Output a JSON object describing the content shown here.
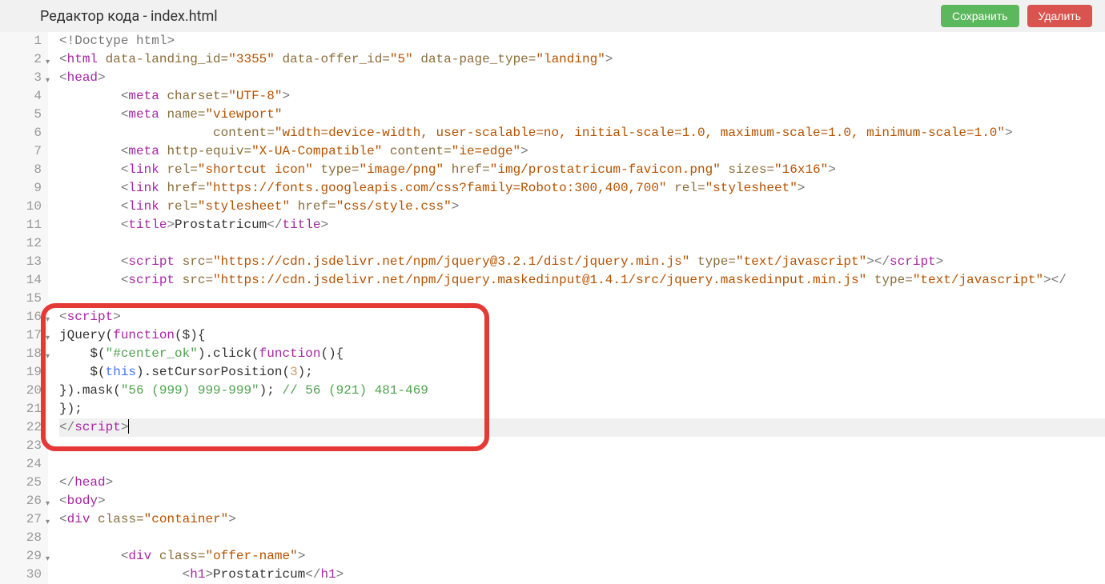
{
  "header": {
    "title": "Редактор кода - index.html",
    "save_label": "Сохранить",
    "delete_label": "Удалить"
  },
  "editor": {
    "active_line": 22,
    "lines": [
      {
        "n": 1,
        "fold": false,
        "tokens": [
          [
            "angle",
            "<"
          ],
          [
            "doctype",
            "!Doctype html"
          ],
          [
            "angle",
            ">"
          ]
        ]
      },
      {
        "n": 2,
        "fold": true,
        "tokens": [
          [
            "angle",
            "<"
          ],
          [
            "name",
            "html"
          ],
          [
            "text",
            " "
          ],
          [
            "attr",
            "data-landing_id"
          ],
          [
            "eq",
            "="
          ],
          [
            "str",
            "\"3355\""
          ],
          [
            "text",
            " "
          ],
          [
            "attr",
            "data-offer_id"
          ],
          [
            "eq",
            "="
          ],
          [
            "str",
            "\"5\""
          ],
          [
            "text",
            " "
          ],
          [
            "attr",
            "data-page_type"
          ],
          [
            "eq",
            "="
          ],
          [
            "str",
            "\"landing\""
          ],
          [
            "angle",
            ">"
          ]
        ]
      },
      {
        "n": 3,
        "fold": true,
        "tokens": [
          [
            "angle",
            "<"
          ],
          [
            "name",
            "head"
          ],
          [
            "angle",
            ">"
          ]
        ]
      },
      {
        "n": 4,
        "fold": false,
        "indent": 2,
        "tokens": [
          [
            "angle",
            "<"
          ],
          [
            "name",
            "meta"
          ],
          [
            "text",
            " "
          ],
          [
            "attr",
            "charset"
          ],
          [
            "eq",
            "="
          ],
          [
            "str",
            "\"UTF-8\""
          ],
          [
            "angle",
            ">"
          ]
        ]
      },
      {
        "n": 5,
        "fold": false,
        "indent": 2,
        "tokens": [
          [
            "angle",
            "<"
          ],
          [
            "name",
            "meta"
          ],
          [
            "text",
            " "
          ],
          [
            "attr",
            "name"
          ],
          [
            "eq",
            "="
          ],
          [
            "str",
            "\"viewport\""
          ]
        ]
      },
      {
        "n": 6,
        "fold": false,
        "indent": 5,
        "tokens": [
          [
            "attr",
            "content"
          ],
          [
            "eq",
            "="
          ],
          [
            "str",
            "\"width=device-width, user-scalable=no, initial-scale=1.0, maximum-scale=1.0, minimum-scale=1.0\""
          ],
          [
            "angle",
            ">"
          ]
        ]
      },
      {
        "n": 7,
        "fold": false,
        "indent": 2,
        "tokens": [
          [
            "angle",
            "<"
          ],
          [
            "name",
            "meta"
          ],
          [
            "text",
            " "
          ],
          [
            "attr",
            "http-equiv"
          ],
          [
            "eq",
            "="
          ],
          [
            "str",
            "\"X-UA-Compatible\""
          ],
          [
            "text",
            " "
          ],
          [
            "attr",
            "content"
          ],
          [
            "eq",
            "="
          ],
          [
            "str",
            "\"ie=edge\""
          ],
          [
            "angle",
            ">"
          ]
        ]
      },
      {
        "n": 8,
        "fold": false,
        "indent": 2,
        "tokens": [
          [
            "angle",
            "<"
          ],
          [
            "name",
            "link"
          ],
          [
            "text",
            " "
          ],
          [
            "attr",
            "rel"
          ],
          [
            "eq",
            "="
          ],
          [
            "str",
            "\"shortcut icon\""
          ],
          [
            "text",
            " "
          ],
          [
            "attr",
            "type"
          ],
          [
            "eq",
            "="
          ],
          [
            "str",
            "\"image/png\""
          ],
          [
            "text",
            " "
          ],
          [
            "attr",
            "href"
          ],
          [
            "eq",
            "="
          ],
          [
            "str",
            "\"img/prostatricum-favicon.png\""
          ],
          [
            "text",
            " "
          ],
          [
            "attr",
            "sizes"
          ],
          [
            "eq",
            "="
          ],
          [
            "str",
            "\"16x16\""
          ],
          [
            "angle",
            ">"
          ]
        ]
      },
      {
        "n": 9,
        "fold": false,
        "indent": 2,
        "tokens": [
          [
            "angle",
            "<"
          ],
          [
            "name",
            "link"
          ],
          [
            "text",
            " "
          ],
          [
            "attr",
            "href"
          ],
          [
            "eq",
            "="
          ],
          [
            "str",
            "\"https://fonts.googleapis.com/css?family=Roboto:300,400,700\""
          ],
          [
            "text",
            " "
          ],
          [
            "attr",
            "rel"
          ],
          [
            "eq",
            "="
          ],
          [
            "str",
            "\"stylesheet\""
          ],
          [
            "angle",
            ">"
          ]
        ]
      },
      {
        "n": 10,
        "fold": false,
        "indent": 2,
        "tokens": [
          [
            "angle",
            "<"
          ],
          [
            "name",
            "link"
          ],
          [
            "text",
            " "
          ],
          [
            "attr",
            "rel"
          ],
          [
            "eq",
            "="
          ],
          [
            "str",
            "\"stylesheet\""
          ],
          [
            "text",
            " "
          ],
          [
            "attr",
            "href"
          ],
          [
            "eq",
            "="
          ],
          [
            "str",
            "\"css/style.css\""
          ],
          [
            "angle",
            ">"
          ]
        ]
      },
      {
        "n": 11,
        "fold": false,
        "indent": 2,
        "tokens": [
          [
            "angle",
            "<"
          ],
          [
            "name",
            "title"
          ],
          [
            "angle",
            ">"
          ],
          [
            "text",
            "Prostatricum"
          ],
          [
            "angle",
            "</"
          ],
          [
            "name",
            "title"
          ],
          [
            "angle",
            ">"
          ]
        ]
      },
      {
        "n": 12,
        "fold": false,
        "tokens": []
      },
      {
        "n": 13,
        "fold": false,
        "indent": 2,
        "tokens": [
          [
            "angle",
            "<"
          ],
          [
            "name",
            "script"
          ],
          [
            "text",
            " "
          ],
          [
            "attr",
            "src"
          ],
          [
            "eq",
            "="
          ],
          [
            "str",
            "\"https://cdn.jsdelivr.net/npm/jquery@3.2.1/dist/jquery.min.js\""
          ],
          [
            "text",
            " "
          ],
          [
            "attr",
            "type"
          ],
          [
            "eq",
            "="
          ],
          [
            "str",
            "\"text/javascript\""
          ],
          [
            "angle",
            ">"
          ],
          [
            "angle",
            "</"
          ],
          [
            "name",
            "script"
          ],
          [
            "angle",
            ">"
          ]
        ]
      },
      {
        "n": 14,
        "fold": false,
        "indent": 2,
        "tokens": [
          [
            "angle",
            "<"
          ],
          [
            "name",
            "script"
          ],
          [
            "text",
            " "
          ],
          [
            "attr",
            "src"
          ],
          [
            "eq",
            "="
          ],
          [
            "str",
            "\"https://cdn.jsdelivr.net/npm/jquery.maskedinput@1.4.1/src/jquery.maskedinput.min.js\""
          ],
          [
            "text",
            " "
          ],
          [
            "attr",
            "type"
          ],
          [
            "eq",
            "="
          ],
          [
            "str",
            "\"text/javascript\""
          ],
          [
            "angle",
            ">"
          ],
          [
            "angle",
            "</"
          ]
        ]
      },
      {
        "n": 15,
        "fold": false,
        "tokens": []
      },
      {
        "n": 16,
        "fold": true,
        "tokens": [
          [
            "angle",
            "<"
          ],
          [
            "name",
            "script"
          ],
          [
            "angle",
            ">"
          ]
        ]
      },
      {
        "n": 17,
        "fold": true,
        "tokens": [
          [
            "js-var",
            "jQuery"
          ],
          [
            "text",
            "("
          ],
          [
            "js-kw",
            "function"
          ],
          [
            "text",
            "($){"
          ]
        ]
      },
      {
        "n": 18,
        "fold": true,
        "indent": 1,
        "tokens": [
          [
            "text",
            "$("
          ],
          [
            "js-str",
            "\"#center_ok\""
          ],
          [
            "text",
            ")."
          ],
          [
            "js-var",
            "click"
          ],
          [
            "text",
            "("
          ],
          [
            "js-kw",
            "function"
          ],
          [
            "text",
            "(){"
          ]
        ]
      },
      {
        "n": 19,
        "fold": false,
        "indent": 1,
        "tokens": [
          [
            "text",
            "$("
          ],
          [
            "js-this",
            "this"
          ],
          [
            "text",
            ")."
          ],
          [
            "js-var",
            "setCursorPosition"
          ],
          [
            "text",
            "("
          ],
          [
            "js-num",
            "3"
          ],
          [
            "text",
            ");"
          ]
        ]
      },
      {
        "n": 20,
        "fold": false,
        "tokens": [
          [
            "text",
            "})."
          ],
          [
            "js-var",
            "mask"
          ],
          [
            "text",
            "("
          ],
          [
            "js-str",
            "\"56 (999) 999-999\""
          ],
          [
            "text",
            "); "
          ],
          [
            "js-comment",
            "// 56 (921) 481-469"
          ]
        ]
      },
      {
        "n": 21,
        "fold": false,
        "tokens": [
          [
            "text",
            "});"
          ]
        ]
      },
      {
        "n": 22,
        "fold": false,
        "active": true,
        "tokens": [
          [
            "angle",
            "</"
          ],
          [
            "name",
            "script"
          ],
          [
            "angle",
            ">"
          ],
          [
            "cursor",
            ""
          ]
        ]
      },
      {
        "n": 23,
        "fold": false,
        "tokens": []
      },
      {
        "n": 24,
        "fold": false,
        "tokens": []
      },
      {
        "n": 25,
        "fold": false,
        "tokens": [
          [
            "angle",
            "</"
          ],
          [
            "name",
            "head"
          ],
          [
            "angle",
            ">"
          ]
        ]
      },
      {
        "n": 26,
        "fold": true,
        "tokens": [
          [
            "angle",
            "<"
          ],
          [
            "name",
            "body"
          ],
          [
            "angle",
            ">"
          ]
        ]
      },
      {
        "n": 27,
        "fold": true,
        "tokens": [
          [
            "angle",
            "<"
          ],
          [
            "name",
            "div"
          ],
          [
            "text",
            " "
          ],
          [
            "attr",
            "class"
          ],
          [
            "eq",
            "="
          ],
          [
            "str",
            "\"container\""
          ],
          [
            "angle",
            ">"
          ]
        ]
      },
      {
        "n": 28,
        "fold": false,
        "tokens": []
      },
      {
        "n": 29,
        "fold": true,
        "indent": 2,
        "tokens": [
          [
            "angle",
            "<"
          ],
          [
            "name",
            "div"
          ],
          [
            "text",
            " "
          ],
          [
            "attr",
            "class"
          ],
          [
            "eq",
            "="
          ],
          [
            "str",
            "\"offer-name\""
          ],
          [
            "angle",
            ">"
          ]
        ]
      },
      {
        "n": 30,
        "fold": false,
        "indent": 4,
        "tokens": [
          [
            "angle",
            "<"
          ],
          [
            "name",
            "h1"
          ],
          [
            "angle",
            ">"
          ],
          [
            "text",
            "Prostatricum"
          ],
          [
            "angle",
            "</"
          ],
          [
            "name",
            "h1"
          ],
          [
            "angle",
            ">"
          ]
        ]
      }
    ]
  }
}
